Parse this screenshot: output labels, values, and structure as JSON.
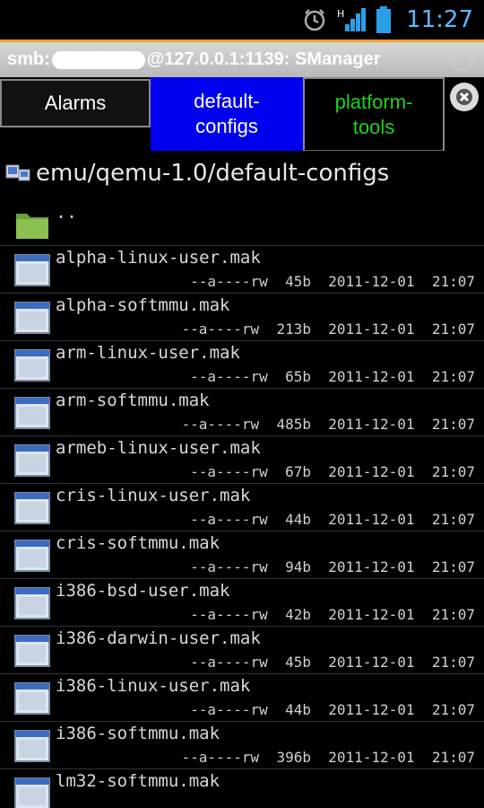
{
  "status": {
    "time": "11:27",
    "icons": [
      "alarm-clock-icon",
      "signal-icon",
      "battery-icon"
    ]
  },
  "title": {
    "prefix": "smb:",
    "suffix": "@127.0.0.1:1139: SManager"
  },
  "tabs": [
    {
      "label": "Alarms",
      "active": false
    },
    {
      "label": "default-\nconfigs",
      "active": true
    },
    {
      "label": "platform-\ntools",
      "active": false
    }
  ],
  "path": "emu/qemu-1.0/default-configs",
  "parent": "..",
  "files": [
    {
      "name": "alpha-linux-user.mak",
      "attrs": "--a----rw",
      "size": "45b",
      "date": "2011-12-01",
      "time": "21:07"
    },
    {
      "name": "alpha-softmmu.mak",
      "attrs": "--a----rw",
      "size": "213b",
      "date": "2011-12-01",
      "time": "21:07"
    },
    {
      "name": "arm-linux-user.mak",
      "attrs": "--a----rw",
      "size": "65b",
      "date": "2011-12-01",
      "time": "21:07"
    },
    {
      "name": "arm-softmmu.mak",
      "attrs": "--a----rw",
      "size": "485b",
      "date": "2011-12-01",
      "time": "21:07"
    },
    {
      "name": "armeb-linux-user.mak",
      "attrs": "--a----rw",
      "size": "67b",
      "date": "2011-12-01",
      "time": "21:07"
    },
    {
      "name": "cris-linux-user.mak",
      "attrs": "--a----rw",
      "size": "44b",
      "date": "2011-12-01",
      "time": "21:07"
    },
    {
      "name": "cris-softmmu.mak",
      "attrs": "--a----rw",
      "size": "94b",
      "date": "2011-12-01",
      "time": "21:07"
    },
    {
      "name": "i386-bsd-user.mak",
      "attrs": "--a----rw",
      "size": "42b",
      "date": "2011-12-01",
      "time": "21:07"
    },
    {
      "name": "i386-darwin-user.mak",
      "attrs": "--a----rw",
      "size": "45b",
      "date": "2011-12-01",
      "time": "21:07"
    },
    {
      "name": "i386-linux-user.mak",
      "attrs": "--a----rw",
      "size": "44b",
      "date": "2011-12-01",
      "time": "21:07"
    },
    {
      "name": "i386-softmmu.mak",
      "attrs": "--a----rw",
      "size": "396b",
      "date": "2011-12-01",
      "time": "21:07"
    },
    {
      "name": "lm32-softmmu.mak",
      "attrs": "",
      "size": "",
      "date": "",
      "time": ""
    }
  ],
  "colors": {
    "active_tab": "#0000ee",
    "platform_tab_text": "#1ed21e",
    "clock": "#5bb8ff",
    "title_accent": "#f0a020"
  }
}
